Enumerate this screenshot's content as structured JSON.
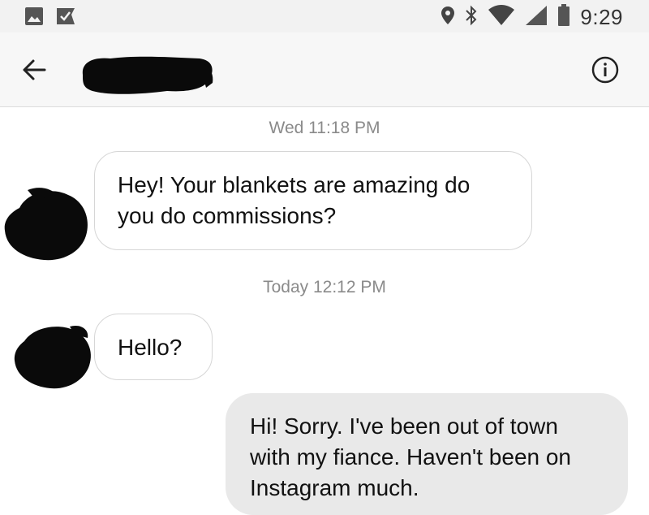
{
  "status_bar": {
    "time": "9:29",
    "icons": [
      "image-icon",
      "check-notification-icon",
      "location-pin-icon",
      "bluetooth-icon",
      "wifi-icon",
      "signal-icon",
      "battery-icon"
    ]
  },
  "header": {
    "back_icon": "arrow-left-icon",
    "contact_name": "",
    "info_icon": "info-icon"
  },
  "conversation": {
    "timestamp_1": "Wed 11:18 PM",
    "timestamp_2": "Today 12:12 PM",
    "messages": [
      {
        "direction": "incoming",
        "text": "Hey! Your blankets are amazing do you do commissions?"
      },
      {
        "direction": "incoming",
        "text": "Hello?"
      },
      {
        "direction": "outgoing",
        "text": "Hi! Sorry. I've been out of town with my fiance. Haven't been on Instagram much."
      }
    ]
  },
  "colors": {
    "incoming_bubble_bg": "#ffffff",
    "incoming_bubble_border": "#d6d6d6",
    "outgoing_bubble_bg": "#e9e9e9",
    "redaction": "#0a0a0a",
    "timestamp_text": "#8a8a8a"
  }
}
